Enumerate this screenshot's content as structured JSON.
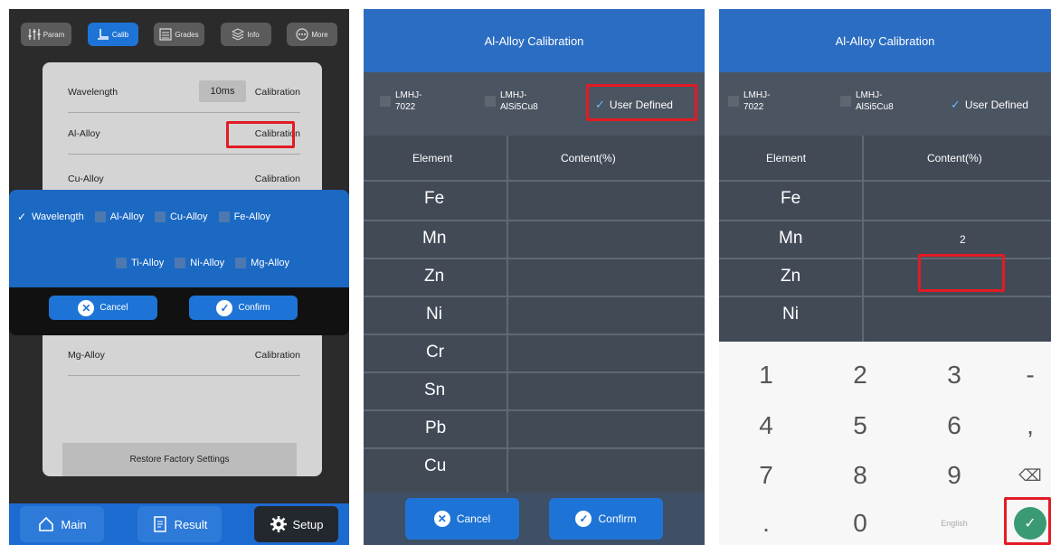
{
  "panel1": {
    "topbar": [
      {
        "label": "Param",
        "icon": "sliders-icon",
        "active": false
      },
      {
        "label": "Calib",
        "icon": "calibrate-icon",
        "active": true
      },
      {
        "label": "Grades",
        "icon": "list-icon",
        "active": false
      },
      {
        "label": "Info",
        "icon": "layers-icon",
        "active": false
      },
      {
        "label": "More",
        "icon": "more-icon",
        "active": false
      }
    ],
    "rows": [
      {
        "name": "Wavelength",
        "time": "10ms",
        "action": "Calibration"
      },
      {
        "name": "Al-Alloy",
        "action": "Calibration"
      },
      {
        "name": "Cu-Alloy",
        "action": "Calibration"
      },
      {
        "name": "Mg-Alloy",
        "action": "Calibration"
      }
    ],
    "restore_label": "Restore Factory Settings",
    "overlay": {
      "row1": [
        "Wavelength",
        "Al-Alloy",
        "Cu-Alloy",
        "Fe-Alloy"
      ],
      "row2": [
        "Ti-Alloy",
        "Ni-Alloy",
        "Mg-Alloy"
      ],
      "checked": "Wavelength",
      "cancel": "Cancel",
      "confirm": "Confirm"
    },
    "nav": {
      "main": "Main",
      "result": "Result",
      "setup": "Setup"
    }
  },
  "panel2": {
    "title": "Al-Alloy Calibration",
    "options": [
      {
        "line1": "LMHJ-",
        "line2": "7022"
      },
      {
        "line1": "LMHJ-",
        "line2": "AlSi5Cu8"
      }
    ],
    "user_defined": "User Defined",
    "col_element": "Element",
    "col_content": "Content(%)",
    "elements": [
      "Fe",
      "Mn",
      "Zn",
      "Ni",
      "Cr",
      "Sn",
      "Pb",
      "Cu"
    ],
    "cancel": "Cancel",
    "confirm": "Confirm"
  },
  "panel3": {
    "title": "Al-Alloy Calibration",
    "options": [
      {
        "line1": "LMHJ-",
        "line2": "7022"
      },
      {
        "line1": "LMHJ-",
        "line2": "AlSi5Cu8"
      }
    ],
    "user_defined": "User Defined",
    "col_element": "Element",
    "col_content": "Content(%)",
    "elements": [
      {
        "name": "Fe",
        "value": ""
      },
      {
        "name": "Mn",
        "value": "2"
      },
      {
        "name": "Zn",
        "value": ""
      },
      {
        "name": "Ni",
        "value": ""
      }
    ],
    "keys": [
      "1",
      "2",
      "3",
      "-",
      "4",
      "5",
      "6",
      ",",
      "7",
      "8",
      "9",
      "⌫",
      ".",
      "0",
      "English",
      "✓"
    ]
  },
  "colors": {
    "accent": "#1e74d6",
    "highlight": "#e21b25",
    "ok": "#3a9a73"
  }
}
